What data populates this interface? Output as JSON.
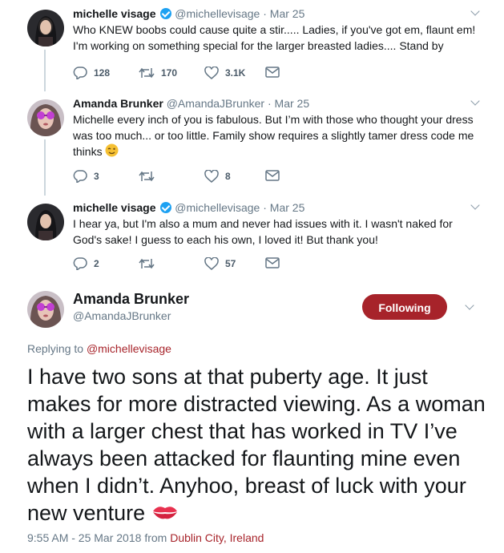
{
  "colors": {
    "accent": "#a7232a",
    "muted": "#657786",
    "verified": "#1da1f2"
  },
  "tweets": [
    {
      "name": "michelle visage",
      "verified": true,
      "handle": "@michellevisage",
      "dot": "·",
      "date": "Mar 25",
      "text": "Who KNEW boobs could cause quite a stir..... Ladies, if you've got em, flaunt em! I'm working on something special for the larger breasted ladies.... Stand by",
      "replies": "128",
      "retweets": "170",
      "likes": "3.1K"
    },
    {
      "name": "Amanda Brunker",
      "verified": false,
      "handle": "@AmandaJBrunker",
      "dot": "·",
      "date": "Mar 25",
      "text": "Michelle every inch of you is fabulous. But I’m with those who thought your dress was too much... or too little. Family show requires a slightly tamer dress code me thinks",
      "emoji": "winking-face",
      "replies": "3",
      "retweets": "",
      "likes": "8"
    },
    {
      "name": "michelle visage",
      "verified": true,
      "handle": "@michellevisage",
      "dot": "·",
      "date": "Mar 25",
      "text": "I hear ya, but I'm also a mum and never had issues with it. I wasn't naked for God's sake! I guess to each his own, I loved it! But thank you!",
      "replies": "2",
      "retweets": "",
      "likes": "57"
    }
  ],
  "main": {
    "name": "Amanda Brunker",
    "handle": "@AmandaJBrunker",
    "follow_label": "Following",
    "replying_prefix": "Replying to",
    "replying_handle": "@michellevisage",
    "text": "I have two sons at that puberty age. It just makes for more distracted viewing. As a woman with a larger chest that has worked in TV I’ve always been attacked for flaunting mine even when I didn’t. Anyhoo, breast of luck with your new venture",
    "emoji": "kiss-mark",
    "timestamp": "9:55 AM - 25 Mar 2018",
    "from_word": "from",
    "location": "Dublin City, Ireland"
  }
}
